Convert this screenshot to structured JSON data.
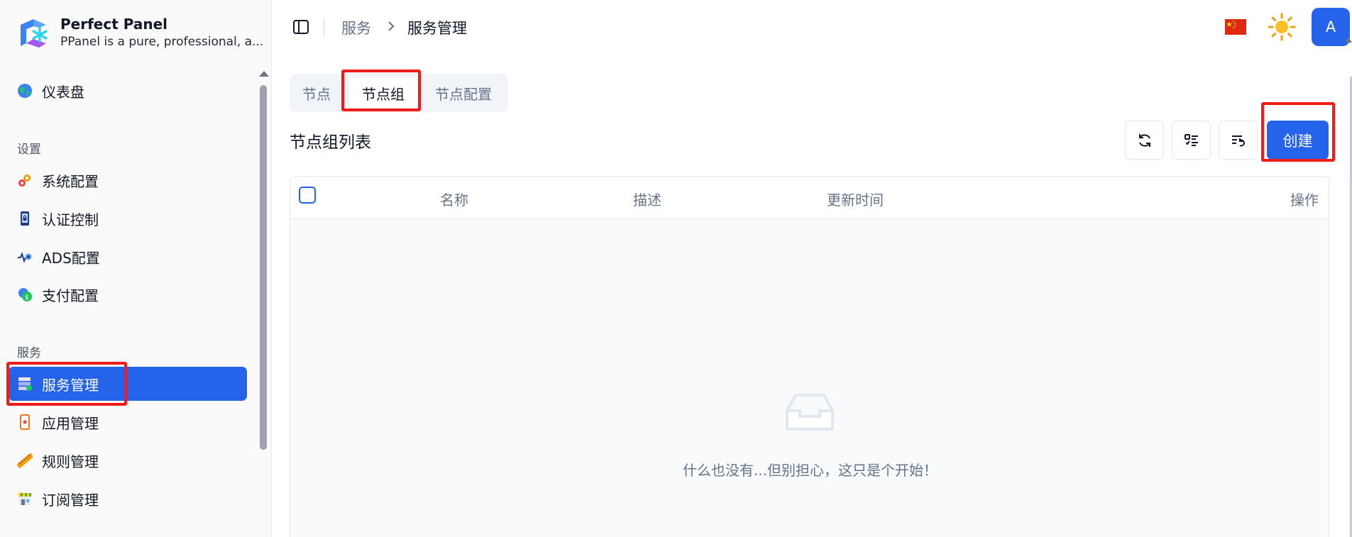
{
  "brand": {
    "title": "Perfect Panel",
    "subtitle": "PPanel is a pure, professional, a..."
  },
  "sidebar": {
    "dashboard": {
      "label": "仪表盘",
      "icon": "globe-icon"
    },
    "sections": [
      {
        "title": "设置",
        "items": [
          {
            "label": "系统配置",
            "icon": "gears-icon"
          },
          {
            "label": "认证控制",
            "icon": "lock-phone-icon"
          },
          {
            "label": "ADS配置",
            "icon": "ads-icon"
          },
          {
            "label": "支付配置",
            "icon": "payment-icon"
          }
        ]
      },
      {
        "title": "服务",
        "items": [
          {
            "label": "服务管理",
            "icon": "server-icon",
            "active": true
          },
          {
            "label": "应用管理",
            "icon": "mobile-app-icon"
          },
          {
            "label": "规则管理",
            "icon": "ruler-icon"
          },
          {
            "label": "订阅管理",
            "icon": "store-icon"
          }
        ]
      }
    ]
  },
  "header": {
    "breadcrumb": [
      "服务",
      "服务管理"
    ],
    "avatar_letter": "A",
    "language_icon": "china-flag-icon",
    "theme_icon": "sun-icon"
  },
  "tabs": [
    {
      "label": "节点",
      "active": false
    },
    {
      "label": "节点组",
      "active": true
    },
    {
      "label": "节点配置",
      "active": false
    }
  ],
  "list": {
    "title": "节点组列表",
    "toolbar": {
      "refresh_icon": "refresh-icon",
      "columns_icon": "column-list-icon",
      "reset_icon": "reset-list-icon",
      "create_label": "创建"
    },
    "columns": [
      "名称",
      "描述",
      "更新时间",
      "操作"
    ],
    "empty_text": "什么也没有...但别担心，这只是个开始！"
  },
  "colors": {
    "primary": "#2563eb",
    "highlight": "#ef1c1c",
    "muted_text": "#64748b"
  }
}
